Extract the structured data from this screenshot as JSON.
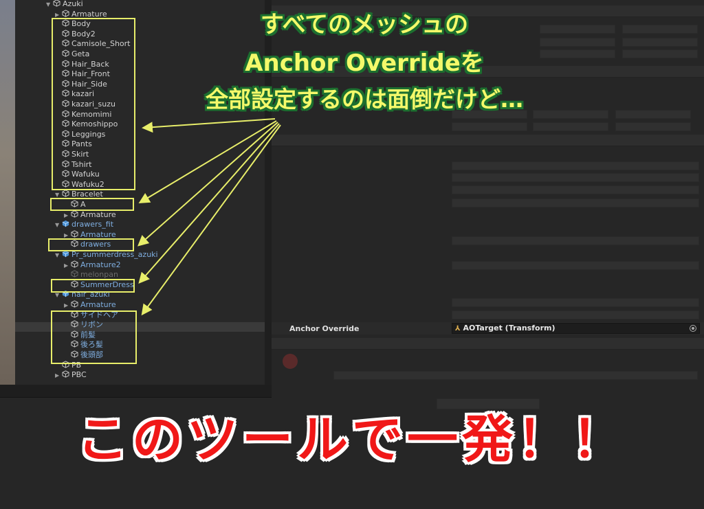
{
  "hierarchy": {
    "rows": [
      {
        "label": "Azuki",
        "indent": 0,
        "arrow": "▼",
        "kind": "object"
      },
      {
        "label": "Armature",
        "indent": 1,
        "arrow": "▶",
        "kind": "object"
      },
      {
        "label": "Body",
        "indent": 1,
        "arrow": "",
        "kind": "object"
      },
      {
        "label": "Body2",
        "indent": 1,
        "arrow": "",
        "kind": "object"
      },
      {
        "label": "Camisole_Short",
        "indent": 1,
        "arrow": "",
        "kind": "object"
      },
      {
        "label": "Geta",
        "indent": 1,
        "arrow": "",
        "kind": "object"
      },
      {
        "label": "Hair_Back",
        "indent": 1,
        "arrow": "",
        "kind": "object"
      },
      {
        "label": "Hair_Front",
        "indent": 1,
        "arrow": "",
        "kind": "object"
      },
      {
        "label": "Hair_Side",
        "indent": 1,
        "arrow": "",
        "kind": "object"
      },
      {
        "label": "kazari",
        "indent": 1,
        "arrow": "",
        "kind": "object"
      },
      {
        "label": "kazari_suzu",
        "indent": 1,
        "arrow": "",
        "kind": "object"
      },
      {
        "label": "Kemomimi",
        "indent": 1,
        "arrow": "",
        "kind": "object"
      },
      {
        "label": "Kemoshippo",
        "indent": 1,
        "arrow": "",
        "kind": "object"
      },
      {
        "label": "Leggings",
        "indent": 1,
        "arrow": "",
        "kind": "object"
      },
      {
        "label": "Pants",
        "indent": 1,
        "arrow": "",
        "kind": "object"
      },
      {
        "label": "Skirt",
        "indent": 1,
        "arrow": "",
        "kind": "object"
      },
      {
        "label": "Tshirt",
        "indent": 1,
        "arrow": "",
        "kind": "object"
      },
      {
        "label": "Wafuku",
        "indent": 1,
        "arrow": "",
        "kind": "object"
      },
      {
        "label": "Wafuku2",
        "indent": 1,
        "arrow": "",
        "kind": "object"
      },
      {
        "label": "Bracelet",
        "indent": 1,
        "arrow": "▼",
        "kind": "object"
      },
      {
        "label": "A",
        "indent": 2,
        "arrow": "",
        "kind": "object"
      },
      {
        "label": "Armature",
        "indent": 2,
        "arrow": "▶",
        "kind": "object"
      },
      {
        "label": "drawers_fit",
        "indent": 1,
        "arrow": "▼",
        "kind": "prefab"
      },
      {
        "label": "Armature",
        "indent": 2,
        "arrow": "▶",
        "kind": "prefab"
      },
      {
        "label": "drawers",
        "indent": 2,
        "arrow": "",
        "kind": "prefab"
      },
      {
        "label": "Pr_summerdress_azuki",
        "indent": 1,
        "arrow": "▼",
        "kind": "prefab"
      },
      {
        "label": "Armature2",
        "indent": 2,
        "arrow": "▶",
        "kind": "prefab"
      },
      {
        "label": "melonpan",
        "indent": 2,
        "arrow": "",
        "kind": "dim"
      },
      {
        "label": "SummerDress",
        "indent": 2,
        "arrow": "",
        "kind": "prefab"
      },
      {
        "label": "hair_azuki",
        "indent": 1,
        "arrow": "▼",
        "kind": "prefab"
      },
      {
        "label": "Armature",
        "indent": 2,
        "arrow": "▶",
        "kind": "prefab"
      },
      {
        "label": "サイドヘア",
        "indent": 2,
        "arrow": "",
        "kind": "prefab"
      },
      {
        "label": "リボン",
        "indent": 2,
        "arrow": "",
        "kind": "prefab"
      },
      {
        "label": "前髪",
        "indent": 2,
        "arrow": "",
        "kind": "prefab"
      },
      {
        "label": "後ろ髪",
        "indent": 2,
        "arrow": "",
        "kind": "prefab"
      },
      {
        "label": "後頭部",
        "indent": 2,
        "arrow": "",
        "kind": "prefab"
      },
      {
        "label": "PB",
        "indent": 1,
        "arrow": "",
        "kind": "object"
      },
      {
        "label": "PBC",
        "indent": 1,
        "arrow": "▶",
        "kind": "object"
      }
    ]
  },
  "inspector": {
    "anchor_override": {
      "label": "Anchor Override",
      "value": "AOTarget (Transform)"
    }
  },
  "caption": {
    "lines": [
      "すべてのメッシュの",
      "Anchor Overrideを",
      "全部設定するのは面倒だけど…"
    ]
  },
  "banner": {
    "text": "このツールで一発！！"
  },
  "colors": {
    "highlight_box": "#e8ee6a",
    "caption_text": "#f4f96a",
    "caption_outline": "#1c6f2f",
    "banner_text": "#f01818",
    "prefab_text": "#7faee0"
  },
  "icons": {
    "object": "cube-icon",
    "prefab": "prefab-cube-icon",
    "picker": "object-picker-icon"
  }
}
